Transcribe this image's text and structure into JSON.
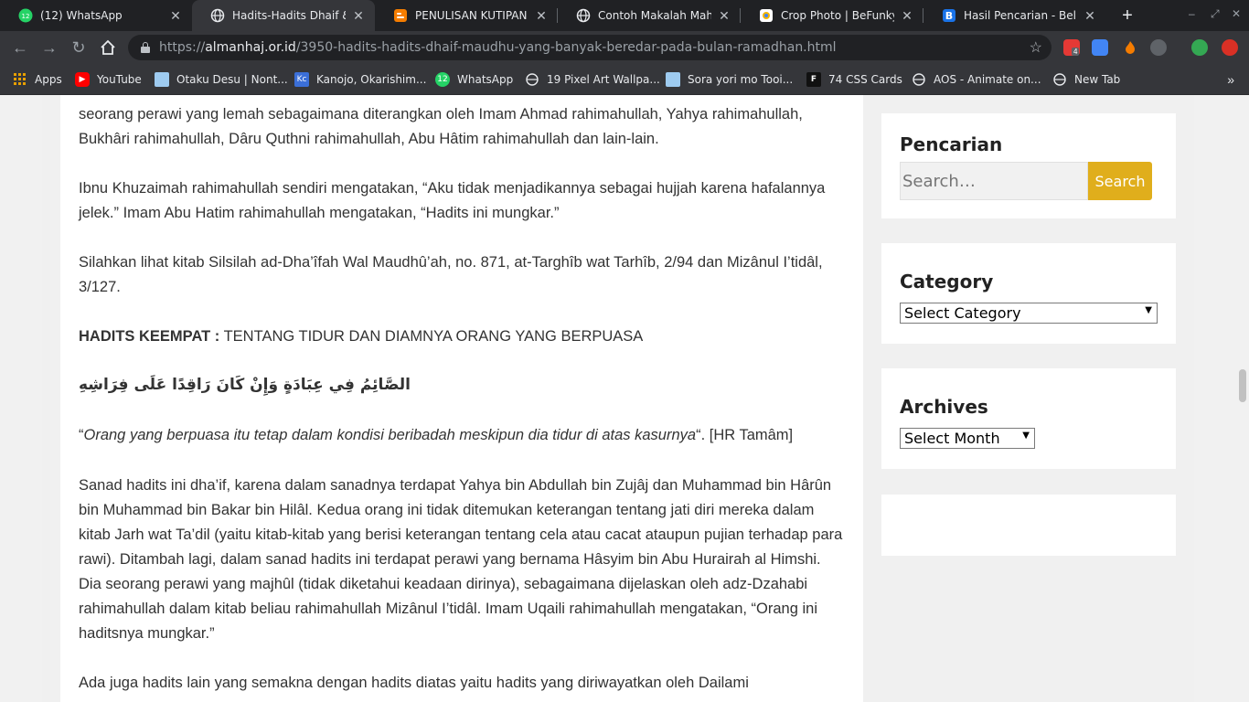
{
  "tabs": [
    {
      "title": "(12) WhatsApp",
      "icon": "whatsapp-icon",
      "active": false
    },
    {
      "title": "Hadits-Hadits Dhaif & M",
      "icon": "globe-icon",
      "active": true
    },
    {
      "title": "PENULISAN KUTIPAN DA",
      "icon": "blogger-icon",
      "active": false
    },
    {
      "title": "Contoh Makalah Mahasi",
      "icon": "globe-icon",
      "active": false
    },
    {
      "title": "Crop Photo | BeFunky: C",
      "icon": "befunky-icon",
      "active": false
    },
    {
      "title": "Hasil Pencarian - Belbuk",
      "icon": "b-icon",
      "active": false
    }
  ],
  "address": {
    "scheme": "https://",
    "host": "almanhaj.or.id",
    "path": "/3950-hadits-hadits-dhaif-maudhu-yang-banyak-beredar-pada-bulan-ramadhan.html"
  },
  "extensions": {
    "badge": "4"
  },
  "bookmarks": [
    {
      "label": "Apps",
      "icon": "apps-grid-icon"
    },
    {
      "label": "YouTube",
      "icon": "youtube-icon"
    },
    {
      "label": "Otaku Desu | Nont...",
      "icon": "page-icon"
    },
    {
      "label": "Kanojo, Okarishim...",
      "icon": "kc-icon"
    },
    {
      "label": "WhatsApp",
      "icon": "whatsapp-icon"
    },
    {
      "label": "19 Pixel Art Wallpa...",
      "icon": "globe-icon"
    },
    {
      "label": "Sora yori mo Tooi...",
      "icon": "page-icon"
    },
    {
      "label": "74 CSS Cards",
      "icon": "f-icon"
    },
    {
      "label": "AOS - Animate on...",
      "icon": "globe-icon"
    },
    {
      "label": "New Tab",
      "icon": "globe-icon"
    }
  ],
  "article": {
    "p0": "seorang perawi yang lemah sebagaimana diterangkan oleh Imam Ahmad rahimahullah, Yahya rahimahullah, Bukhâri rahimahullah, Dâru Quthni rahimahullah, Abu Hâtim rahimahullah dan lain-lain.",
    "p1": "Ibnu Khuzaimah rahimahullah sendiri mengatakan, “Aku tidak menjadikannya sebagai hujjah karena hafalannya jelek.” Imam Abu Hatim rahimahullah mengatakan, “Hadits ini mungkar.”",
    "p2": "Silahkan lihat kitab Silsilah ad-Dha’îfah Wal Maudhû’ah, no. 871, at-Targhîb wat Tarhîb, 2/94 dan Mizânul I’tidâl, 3/127.",
    "heading_bold": "HADITS KEEMPAT :",
    "heading_rest": " TENTANG TIDUR DAN DIAMNYA ORANG YANG BERPUASA",
    "arabic": "الصَّائِمُ فِي عِبَادَةٍ وَإِنْ كَانَ رَاقِدًا عَلَى فِرَاشِهِ",
    "quote_open": "“",
    "quote_italic": "Orang yang berpuasa itu tetap dalam kondisi beribadah meskipun dia tidur di atas kasurnya",
    "quote_close": "“. [HR Tamâm]",
    "p4": "Sanad hadits ini dha’if, karena dalam sanadnya terdapat Yahya bin Abdullah bin Zujâj dan Muhammad bin Hârûn bin Muhammad bin Bakar bin Hilâl. Kedua orang ini tidak ditemukan keterangan tentang jati diri mereka dalam kitab Jarh wat Ta’dil (yaitu kitab-kitab yang berisi keterangan tentang cela atau cacat ataupun pujian terhadap para rawi). Ditambah lagi, dalam sanad hadits ini terdapat perawi yang bernama Hâsyim bin Abu Hurairah al Himshi. Dia seorang perawi yang majhûl (tidak diketahui keadaan dirinya), sebagaimana dijelaskan oleh adz-Dzahabi rahimahullah dalam kitab beliau rahimahullah Mizânul I’tidâl. Imam Uqaili rahimahullah mengatakan, “Orang ini haditsnya mungkar.”",
    "p5": "Ada juga hadits lain yang semakna dengan hadits diatas yaitu hadits yang diriwayatkan oleh Dailami"
  },
  "sidebar": {
    "search_title": "Pencarian",
    "search_placeholder": "Search…",
    "search_button": "Search",
    "category_title": "Category",
    "category_select": "Select Category",
    "archives_title": "Archives",
    "archives_select": "Select Month"
  },
  "colors": {
    "search_button": "#e0ae1c",
    "chrome_dark": "#202124",
    "chrome_toolbar": "#35363a"
  }
}
